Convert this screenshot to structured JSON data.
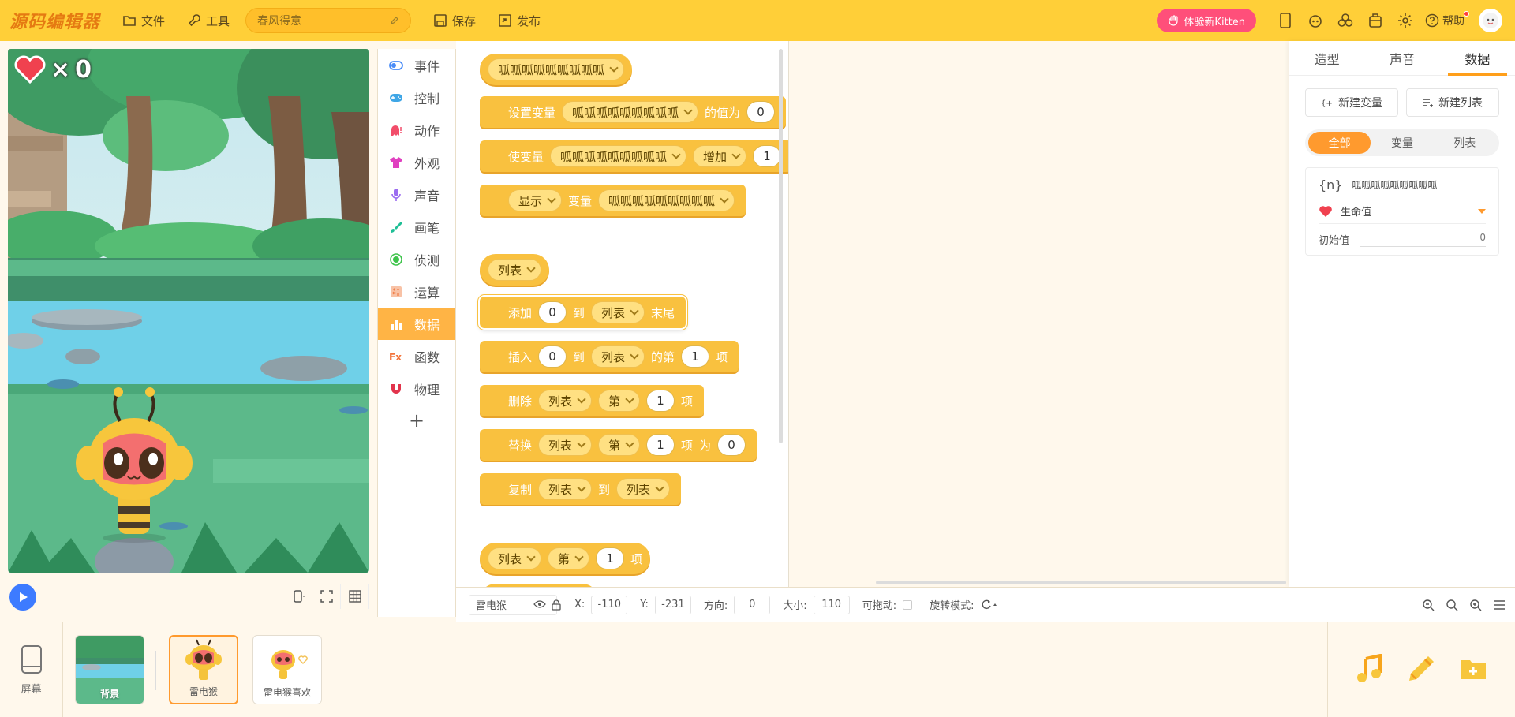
{
  "app": {
    "logo": "源码编辑器"
  },
  "topbar": {
    "file_label": "文件",
    "tools_label": "工具",
    "project_name": "春风得意",
    "save_label": "保存",
    "publish_label": "发布",
    "kitten_label": "体验新Kitten",
    "help_label": "帮助"
  },
  "stage": {
    "lives_text": "×",
    "lives_count": "0"
  },
  "categories": [
    {
      "label": "事件",
      "color": "#4a8cf7"
    },
    {
      "label": "控制",
      "color": "#3fa6e6"
    },
    {
      "label": "动作",
      "color": "#f24d6a"
    },
    {
      "label": "外观",
      "color": "#e040c0"
    },
    {
      "label": "声音",
      "color": "#9b6cf0"
    },
    {
      "label": "画笔",
      "color": "#1fbf96"
    },
    {
      "label": "侦测",
      "color": "#3dc34a"
    },
    {
      "label": "运算",
      "color": "#f59a6a"
    },
    {
      "label": "数据",
      "color": "#ffffff"
    },
    {
      "label": "函数",
      "color": "#f3743b"
    },
    {
      "label": "物理",
      "color": "#e2344c"
    }
  ],
  "blocks": {
    "var_reporter": "呱呱呱呱呱呱呱呱呱",
    "set_var": {
      "prefix": "设置变量",
      "var": "呱呱呱呱呱呱呱呱呱",
      "mid": "的值为",
      "value": "0"
    },
    "change_var": {
      "prefix": "使变量",
      "var": "呱呱呱呱呱呱呱呱呱",
      "op": "增加",
      "value": "1"
    },
    "show_var": {
      "op": "显示",
      "mid": "变量",
      "var": "呱呱呱呱呱呱呱呱呱"
    },
    "list_reporter": "列表",
    "add_to_list": {
      "prefix": "添加",
      "value": "0",
      "to": "到",
      "list": "列表",
      "suffix": "末尾"
    },
    "insert_list": {
      "prefix": "插入",
      "value": "0",
      "to": "到",
      "list": "列表",
      "mid": "的第",
      "index": "1",
      "suffix": "项"
    },
    "delete_list": {
      "prefix": "删除",
      "list": "列表",
      "nth": "第",
      "index": "1",
      "suffix": "项"
    },
    "replace_list": {
      "prefix": "替换",
      "list": "列表",
      "nth": "第",
      "index": "1",
      "item": "项",
      "as": "为",
      "value": "0"
    },
    "copy_list": {
      "prefix": "复制",
      "list": "列表",
      "to": "到",
      "list2": "列表"
    },
    "item_of_list": {
      "list": "列表",
      "nth": "第",
      "index": "1",
      "suffix": "项"
    }
  },
  "right_panel": {
    "tabs": [
      "造型",
      "声音",
      "数据"
    ],
    "active_tab": "数据",
    "new_var_label": "新建变量",
    "new_list_label": "新建列表",
    "filters": [
      "全部",
      "变量",
      "列表"
    ],
    "active_filter": "全部",
    "variable": {
      "brace": "{n}",
      "name": "呱呱呱呱呱呱呱呱呱",
      "type_label": "生命值",
      "init_label": "初始值",
      "init_value": "0"
    }
  },
  "propbar": {
    "sprite_name": "雷电猴",
    "x_label": "X:",
    "x_value": "-110",
    "y_label": "Y:",
    "y_value": "-231",
    "dir_label": "方向:",
    "dir_value": "0",
    "size_label": "大小:",
    "size_value": "110",
    "drag_label": "可拖动:",
    "rotate_label": "旋转模式:"
  },
  "bottom": {
    "screen_label": "屏幕",
    "sprites": [
      {
        "label": "背景"
      },
      {
        "label": "雷电猴"
      },
      {
        "label": "雷电猴喜欢"
      }
    ]
  }
}
